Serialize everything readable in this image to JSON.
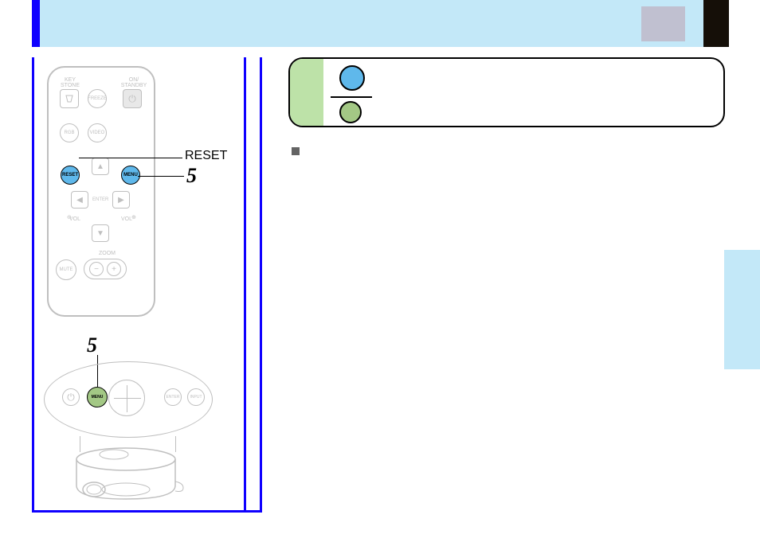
{
  "remote": {
    "labels": {
      "key_stone": "KEY\nSTONE",
      "freeze": "FREEZE",
      "on_standby": "ON/\nSTANDBY",
      "rgb": "RGB",
      "video": "VIDEO",
      "reset": "RESET",
      "menu": "MENU",
      "enter": "ENTER",
      "vol_minus": "VOL",
      "vol_plus": "VOL",
      "mute": "MUTE",
      "zoom": "ZOOM"
    }
  },
  "callouts": {
    "reset": "RESET",
    "step_remote": "5",
    "step_control": "5"
  },
  "control_panel": {
    "labels": {
      "menu": "MENU",
      "enter": "ENTER",
      "input": "INPUT"
    }
  },
  "note": {
    "blue_meaning": "",
    "green_meaning": ""
  }
}
